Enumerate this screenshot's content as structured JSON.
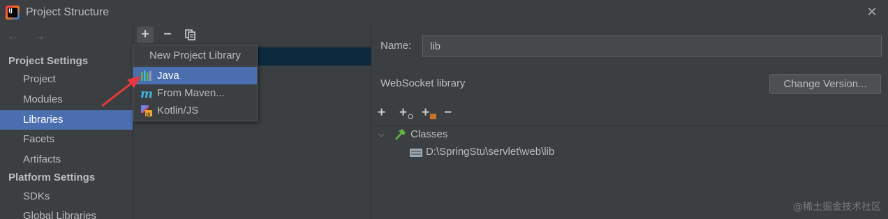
{
  "window": {
    "title": "Project Structure",
    "close_glyph": "✕",
    "app_icon_text": "IJ"
  },
  "nav": {
    "back_forward": "← →",
    "project_settings_header": "Project Settings",
    "project_items": [
      "Project",
      "Modules",
      "Libraries",
      "Facets",
      "Artifacts"
    ],
    "platform_settings_header": "Platform Settings",
    "platform_items": [
      "SDKs",
      "Global Libraries"
    ],
    "selected": "Libraries"
  },
  "middle_toolbar": {
    "add": "+",
    "remove": "−",
    "copy_icon": "copy-icon"
  },
  "popup": {
    "title": "New Project Library",
    "items": [
      {
        "label": "Java",
        "icon": "java-library-icon"
      },
      {
        "label": "From Maven...",
        "icon": "maven-icon"
      },
      {
        "label": "Kotlin/JS",
        "icon": "kotlin-js-icon"
      }
    ],
    "selected": "Java"
  },
  "details": {
    "name_label": "Name:",
    "name_value": "lib",
    "library_type": "WebSocket library",
    "change_version_label": "Change Version...",
    "toolbar": {
      "add": "+",
      "add_url": "+",
      "add_jar": "+",
      "remove": "−"
    },
    "tree": {
      "root_label": "Classes",
      "child_path": "D:\\SpringStu\\servlet\\web\\lib"
    }
  },
  "watermark": "@稀土掘金技术社区",
  "colors": {
    "selection": "#4b6eaf",
    "background": "#3c3f41",
    "annotation_arrow": "#e8383d"
  }
}
